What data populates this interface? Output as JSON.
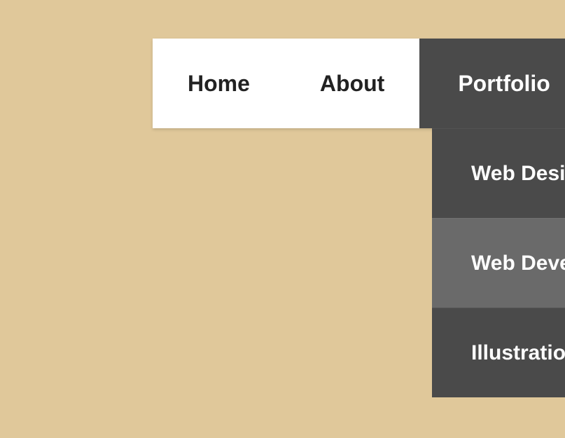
{
  "nav": {
    "items": [
      {
        "label": "Home"
      },
      {
        "label": "About"
      },
      {
        "label": "Portfolio"
      }
    ],
    "dropdown": [
      {
        "label": "Web Design"
      },
      {
        "label": "Web Development"
      },
      {
        "label": "Illustrations"
      }
    ]
  }
}
